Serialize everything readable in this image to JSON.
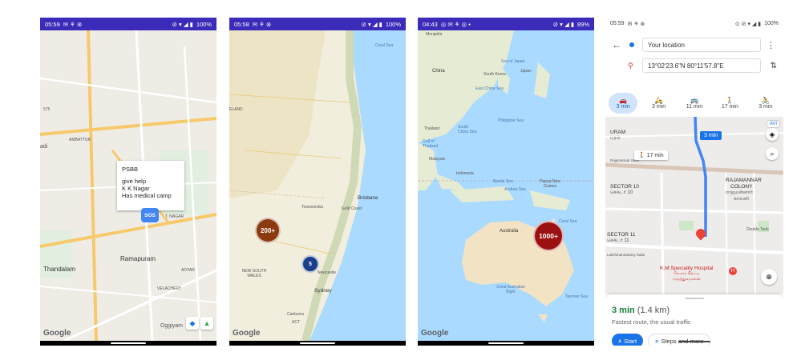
{
  "screens": [
    {
      "status": {
        "time": "05:59",
        "left_icons": "✉ ⚘ ⊛",
        "right_icons": "⊘ ▾ ◢ ▮",
        "battery": "100%"
      },
      "map_labels": [
        "AMBATTUR",
        "T. NAGAR",
        "Ramapuram",
        "Thandalam",
        "ADYAR",
        "VELACHERY",
        "Oggiyam",
        "575",
        "adi"
      ],
      "info_window": {
        "line1": "PSBB",
        "line2": "give help",
        "line3": "K K Nagar",
        "line4": "Has medical camp"
      },
      "marker": "SOS",
      "brand": "Google"
    },
    {
      "status": {
        "time": "05:58",
        "left_icons": "✉ ⚘ ⊛",
        "right_icons": "⊘ ▾ ◢ ▮",
        "battery": "100%"
      },
      "map_labels": [
        "Coral Sea",
        "Brisbane",
        "Gold Coast",
        "Toowoomba",
        "NEW SOUTH WALES",
        "Newcastle",
        "Sydney",
        "Canberra",
        "ACT",
        "ELAND"
      ],
      "clusters": [
        {
          "label": "200+"
        },
        {
          "label": "5"
        }
      ],
      "brand": "Google"
    },
    {
      "status": {
        "time": "04:43",
        "left_icons": "◎ ✉ ⚘ ◎ •",
        "right_icons": "⊘ ▾ ◢ ▮",
        "battery": "89%"
      },
      "map_labels": [
        "Mongolia",
        "China",
        "Sea of Japan",
        "South Korea",
        "Japan",
        "East China Sea",
        "Philippine Sea",
        "Thailand",
        "South China Sea",
        "Gulf of Thailand",
        "Malaysia",
        "Indonesia",
        "Banda Sea",
        "Arafura Sea",
        "Papua New Guinea",
        "Coral Sea",
        "Australia",
        "Great Australian Bight",
        "Tasman Sea"
      ],
      "clusters": [
        {
          "label": "1000+"
        }
      ],
      "brand": "Google"
    },
    {
      "status": {
        "time": "05:59",
        "left_icons": "✉ ⚘ ⊛",
        "right_icons": "⊙ ⊘ ▾ ◢ ▮",
        "battery": "100%"
      },
      "origin": "Your location",
      "destination": "13°02'23.6\"N 80°11'57.8\"E",
      "modes": [
        {
          "icon": "🚗",
          "time": "3 min"
        },
        {
          "icon": "🛵",
          "time": "3 min"
        },
        {
          "icon": "🚌",
          "time": "11 min"
        },
        {
          "icon": "🚶",
          "time": "17 min"
        },
        {
          "icon": "🚴",
          "time": "3 min"
        }
      ],
      "map_labels": [
        "URAM",
        "புரம்",
        "SECTOR 10",
        "செக்டர் 10",
        "RAJAMANNAR",
        "COLONY",
        "ராஜமன்னார்",
        "காலனி",
        "SECTOR 11",
        "செக்டர் 11",
        "Double Tank",
        "Lakshmaniswamy Salai",
        "Rajamannar Salai",
        "3 min",
        "17 min"
      ],
      "poi": "K.M.Speciality Hospital",
      "poi_tamil": "கே.எம் சிறப்பு மருத்துவமனை",
      "route_time": "3 min",
      "route_dist": "(1.4 km)",
      "route_desc": "Fastest route, the usual traffic",
      "start_label": "Start",
      "steps_label": "Steps and more",
      "avatar_label": "AVI"
    }
  ],
  "colors": {
    "status_bar": "#3b2bb8",
    "accent": "#1a73e8",
    "cluster_dark": "#8b3a0f",
    "cluster_blue": "#1c3d8a",
    "cluster_red": "#9b1111",
    "sos": "#4285f4"
  }
}
